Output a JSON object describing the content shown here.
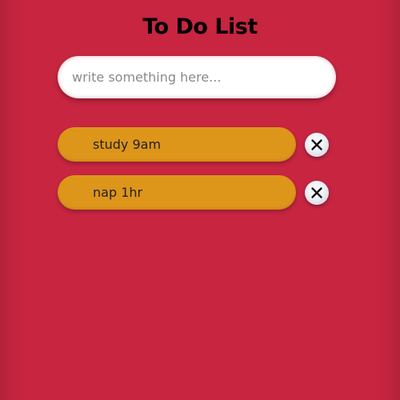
{
  "app": {
    "title": "To Do List"
  },
  "input": {
    "placeholder": "write something here...",
    "value": ""
  },
  "todos": [
    {
      "text": "study 9am",
      "delete_icon": "close-icon"
    },
    {
      "text": "nap 1hr",
      "delete_icon": "close-icon"
    }
  ],
  "colors": {
    "background": "#c72540",
    "item": "#dd951a",
    "input_bg": "#ffffff",
    "title": "#000000"
  }
}
